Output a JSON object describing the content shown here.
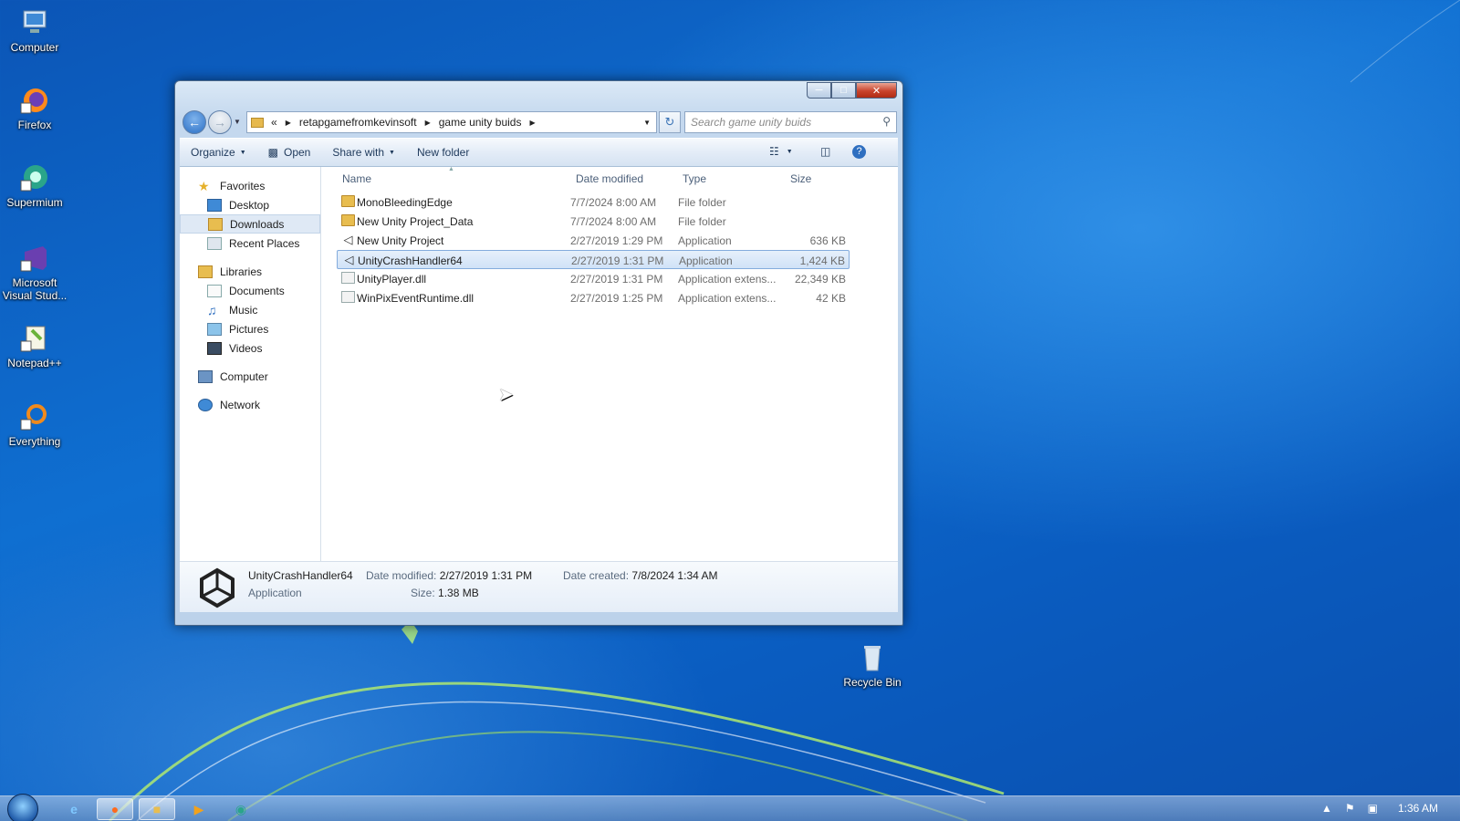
{
  "desktop": {
    "icons": [
      {
        "label": "Computer",
        "icon": "computer-icon"
      },
      {
        "label": "Firefox",
        "icon": "firefox-icon"
      },
      {
        "label": "Supermium",
        "icon": "supermium-icon"
      },
      {
        "label": "Microsoft Visual Stud...",
        "icon": "visual-studio-icon"
      },
      {
        "label": "Notepad++",
        "icon": "notepad-plus-plus-icon"
      },
      {
        "label": "Everything",
        "icon": "everything-icon"
      }
    ],
    "recycle_bin": "Recycle Bin"
  },
  "window": {
    "address": {
      "root_chevrons": "«",
      "segments": [
        "retapgamefromkevinsoft",
        "game unity buids"
      ]
    },
    "search": {
      "placeholder": "Search game unity buids"
    },
    "toolbar": {
      "organize": "Organize",
      "open": "Open",
      "share_with": "Share with",
      "new_folder": "New folder"
    },
    "nav": {
      "favorites": "Favorites",
      "desktop": "Desktop",
      "downloads": "Downloads",
      "recent": "Recent Places",
      "libraries": "Libraries",
      "documents": "Documents",
      "music": "Music",
      "pictures": "Pictures",
      "videos": "Videos",
      "computer": "Computer",
      "network": "Network"
    },
    "columns": {
      "name": "Name",
      "date": "Date modified",
      "type": "Type",
      "size": "Size"
    },
    "files": [
      {
        "name": "MonoBleedingEdge",
        "date": "7/7/2024 8:00 AM",
        "type": "File folder",
        "size": "",
        "kind": "folder"
      },
      {
        "name": "New Unity Project_Data",
        "date": "7/7/2024 8:00 AM",
        "type": "File folder",
        "size": "",
        "kind": "folder"
      },
      {
        "name": "New Unity Project",
        "date": "2/27/2019 1:29 PM",
        "type": "Application",
        "size": "636 KB",
        "kind": "app"
      },
      {
        "name": "UnityCrashHandler64",
        "date": "2/27/2019 1:31 PM",
        "type": "Application",
        "size": "1,424 KB",
        "kind": "app",
        "selected": true
      },
      {
        "name": "UnityPlayer.dll",
        "date": "2/27/2019 1:31 PM",
        "type": "Application extens...",
        "size": "22,349 KB",
        "kind": "dll"
      },
      {
        "name": "WinPixEventRuntime.dll",
        "date": "2/27/2019 1:25 PM",
        "type": "Application extens...",
        "size": "42 KB",
        "kind": "dll"
      }
    ],
    "details": {
      "name": "UnityCrashHandler64",
      "kind": "Application",
      "date_modified_label": "Date modified:",
      "date_modified": "2/27/2019 1:31 PM",
      "size_label": "Size:",
      "size": "1.38 MB",
      "date_created_label": "Date created:",
      "date_created": "7/8/2024 1:34 AM"
    }
  },
  "taskbar": {
    "clock": "1:36 AM"
  },
  "colors": {
    "accent": "#3b74b6",
    "selection": "#d0e2f7",
    "close": "#c9432c"
  }
}
